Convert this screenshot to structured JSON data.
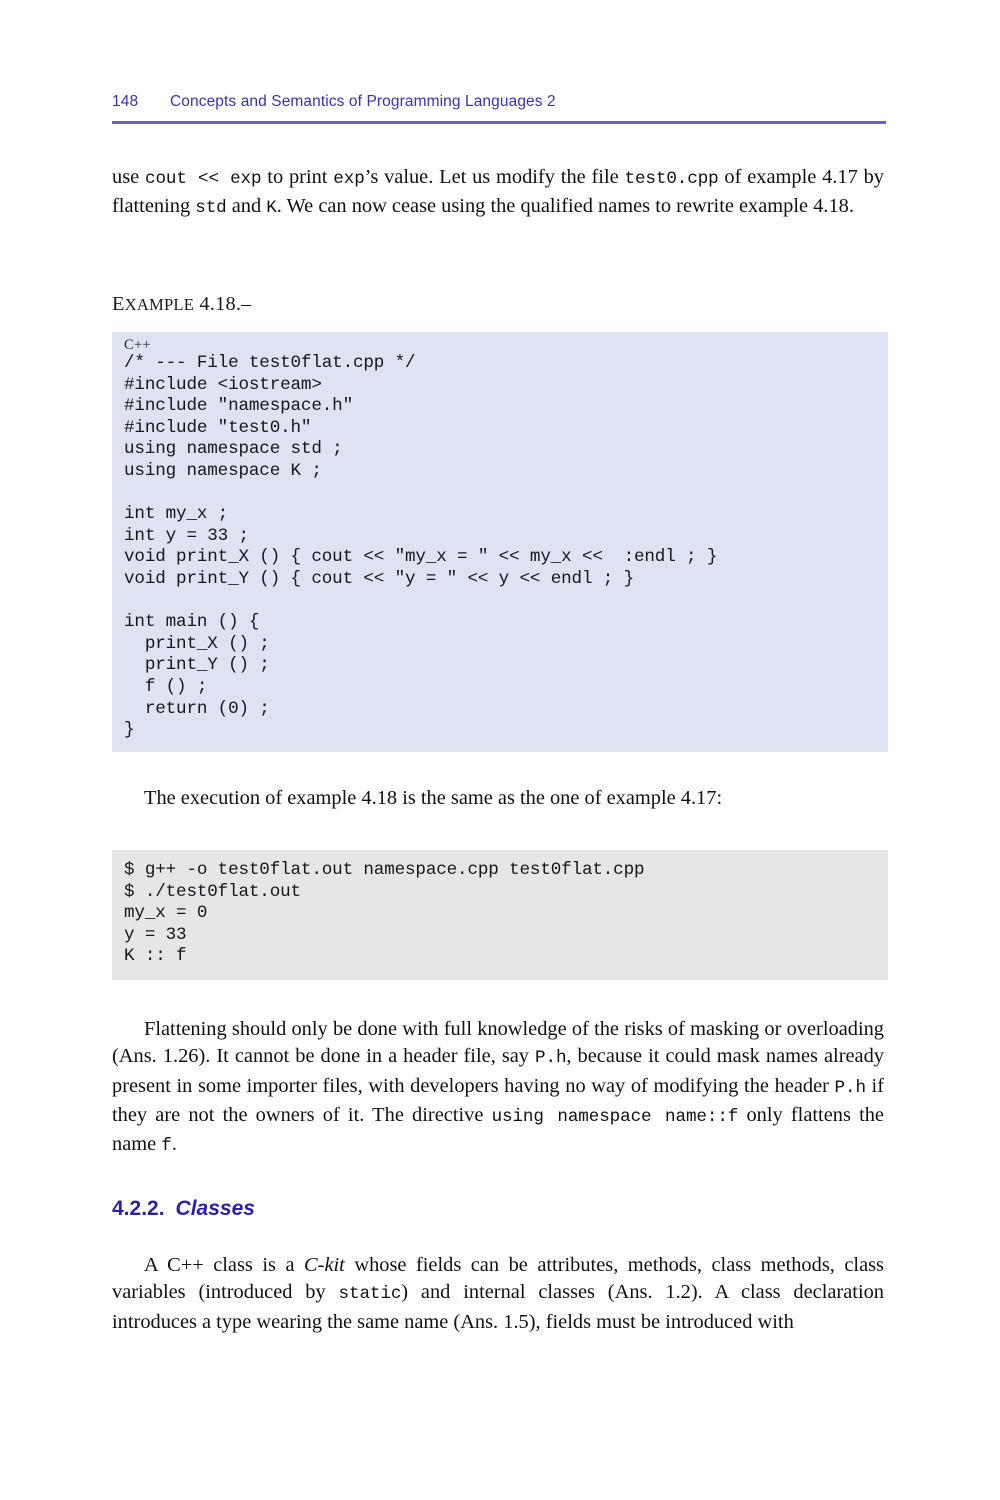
{
  "header": {
    "folio": "148",
    "title": "Concepts and Semantics of Programming Languages 2"
  },
  "paragraphs": {
    "intro_1": "use ",
    "intro_code_1": "cout << exp",
    "intro_2": " to print ",
    "intro_code_2": "exp",
    "intro_3": "’s value. Let us modify the file ",
    "intro_code_3": "test0.cpp",
    "intro_4": " of example 4.17 by flattening ",
    "intro_code_4": "std",
    "intro_5": " and ",
    "intro_code_5": "K",
    "intro_6": ". We can now cease using the qualified names to rewrite example 4.18.",
    "between": "The execution of example 4.18 is the same as the one of example 4.17:",
    "flatten_1": "Flattening should only be done with full knowledge of the risks of masking or overloading (Ans. 1.26). It cannot be done in a header file, say ",
    "flatten_code_1": "P.h",
    "flatten_2": ", because it could mask names already present in some importer files, with developers having no way of modifying the header ",
    "flatten_code_2": "P.h",
    "flatten_3": " if they are not the owners of it. The directive ",
    "flatten_code_3": "using namespace name::f",
    "flatten_4": " only flattens the name ",
    "flatten_code_4": "f",
    "flatten_5": ".",
    "classes_1": "A C++ class is a ",
    "classes_ital_1": "C-kit",
    "classes_2": " whose fields can be attributes, methods, class methods, class variables (introduced by ",
    "classes_code_1": "static",
    "classes_3": ") and internal classes (Ans. 1.2). A class declaration introduces a type wearing the same name (Ans. 1.5), fields must be introduced with"
  },
  "example_label": {
    "word": "E",
    "word_rest": "XAMPLE",
    "number": " 4.18.–"
  },
  "code_listing": {
    "language_label": "C++",
    "code": "/* --- File test0flat.cpp */\n#include <iostream>\n#include \"namespace.h\"\n#include \"test0.h\"\nusing namespace std ;\nusing namespace K ;\n\nint my_x ;\nint y = 33 ;\nvoid print_X () { cout << \"my_x = \" << my_x <<  :endl ; }\nvoid print_Y () { cout << \"y = \" << y << endl ; }\n\nint main () {\n  print_X () ;\n  print_Y () ;\n  f () ;\n  return (0) ;\n}"
  },
  "terminal_listing": {
    "output": "$ g++ -o test0flat.out namespace.cpp test0flat.cpp\n$ ./test0flat.out\nmy_x = 0\ny = 33\nK :: f"
  },
  "section": {
    "number": "4.2.2.",
    "title": "Classes"
  },
  "colors": {
    "header_text": "#3b30b8",
    "header_rule": "#6b5fc7",
    "section_heading": "#2b1fa8",
    "code_background": "#dde3f0",
    "terminal_background": "#e6e6e6",
    "body_text": "#111111"
  }
}
